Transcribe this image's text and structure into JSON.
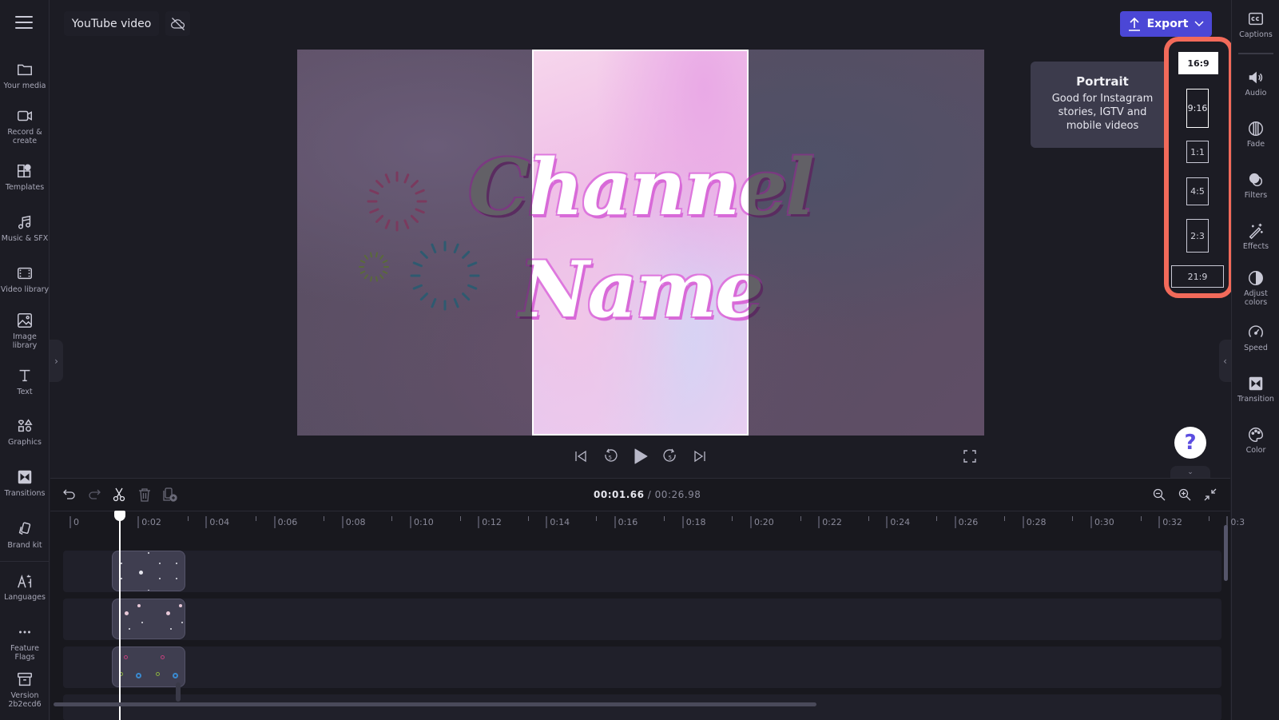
{
  "header": {
    "menu_icon": "hamburger-icon",
    "project_title": "YouTube video",
    "sync_icon": "cloud-off-icon",
    "export_label": "Export",
    "export_color": "#4b47d6"
  },
  "left_sidebar": {
    "items": [
      {
        "label": "Your media",
        "icon": "folder-icon"
      },
      {
        "label": "Record &",
        "label2": "create",
        "icon": "video-camera-icon"
      },
      {
        "label": "Templates",
        "icon": "templates-icon"
      },
      {
        "label": "Music & SFX",
        "icon": "music-note-icon"
      },
      {
        "label": "Video library",
        "icon": "film-icon"
      },
      {
        "label": "Image",
        "label2": "library",
        "icon": "image-icon"
      },
      {
        "label": "Text",
        "icon": "text-icon"
      },
      {
        "label": "Graphics",
        "icon": "shapes-icon"
      },
      {
        "label": "Transitions",
        "icon": "transition-icon"
      },
      {
        "label": "Brand kit",
        "icon": "brand-kit-icon"
      },
      {
        "label": "Languages",
        "icon": "language-icon"
      },
      {
        "label": "Feature",
        "label2": "Flags",
        "icon": "more-dots-icon"
      },
      {
        "label": "Version",
        "label2": "2b2ecd6",
        "icon": "archive-icon"
      }
    ]
  },
  "preview": {
    "title_line1": "Channel",
    "title_line2": "Name",
    "crop_mode": "9:16"
  },
  "player": {
    "controls": [
      "skip-to-start",
      "rewind-5s",
      "play",
      "forward-5s",
      "skip-to-end",
      "fullscreen"
    ],
    "rewind_label": "5",
    "forward_label": "5"
  },
  "tooltip": {
    "title": "Portrait",
    "body": "Good for Instagram stories, IGTV and mobile videos"
  },
  "aspect_ratios": {
    "options": [
      "16:9",
      "9:16",
      "1:1",
      "4:5",
      "2:3",
      "21:9"
    ],
    "selected": "16:9",
    "hovered": "9:16",
    "highlight_color": "#f26a5a"
  },
  "right_sidebar": {
    "items": [
      {
        "label": "Captions",
        "icon": "captions-icon"
      },
      {
        "label": "Audio",
        "icon": "speaker-icon"
      },
      {
        "label": "Fade",
        "icon": "fade-icon"
      },
      {
        "label": "Filters",
        "icon": "filters-icon"
      },
      {
        "label": "Effects",
        "icon": "magic-wand-icon"
      },
      {
        "label": "Adjust",
        "label2": "colors",
        "icon": "contrast-icon"
      },
      {
        "label": "Speed",
        "icon": "speedometer-icon"
      },
      {
        "label": "Transition",
        "icon": "transition-icon"
      },
      {
        "label": "Color",
        "icon": "palette-icon"
      }
    ],
    "help_label": "?"
  },
  "timeline": {
    "tools": [
      "undo",
      "redo",
      "split",
      "delete",
      "add-to-media"
    ],
    "current_time": "00:01.66",
    "separator": "/",
    "total_time": "00:26.98",
    "ruler_labels": [
      "0",
      "0:02",
      "0:04",
      "0:06",
      "0:08",
      "0:10",
      "0:12",
      "0:14",
      "0:16",
      "0:18",
      "0:20",
      "0:22",
      "0:24",
      "0:26",
      "0:28",
      "0:30",
      "0:32",
      "0:3"
    ],
    "tracks": [
      {
        "clip": "stars-overlay"
      },
      {
        "clip": "sparkles-overlay"
      },
      {
        "clip": "circles-overlay"
      },
      {
        "clip": ""
      }
    ],
    "zoom_tools": [
      "zoom-out",
      "zoom-in",
      "fit-to-screen"
    ]
  }
}
